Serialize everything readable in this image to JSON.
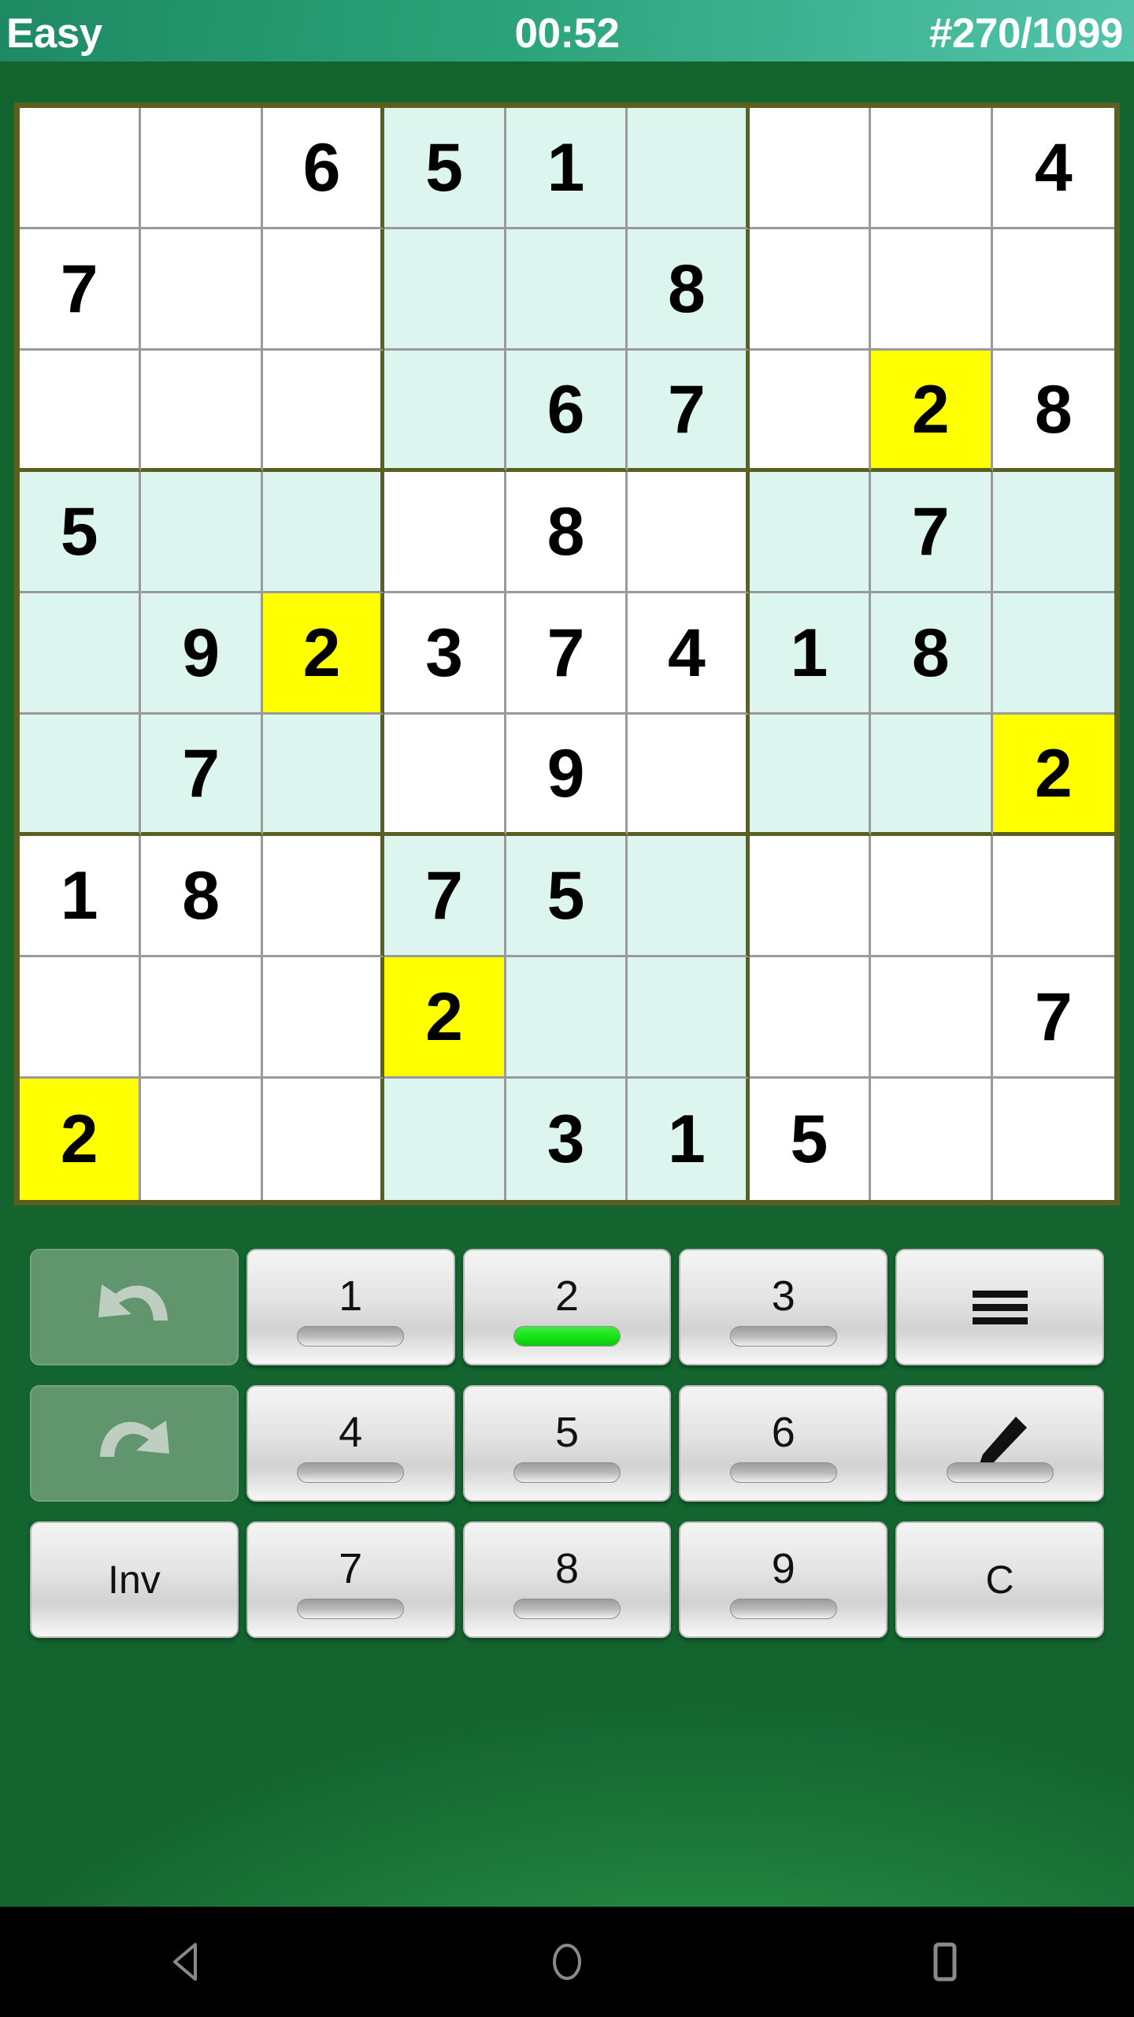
{
  "header": {
    "difficulty": "Easy",
    "timer": "00:52",
    "puzzle_progress": "#270/1099"
  },
  "board": {
    "rows": [
      [
        "",
        "",
        "6",
        "5",
        "1",
        "",
        "",
        "",
        "4"
      ],
      [
        "7",
        "",
        "",
        "",
        "",
        "8",
        "",
        "",
        ""
      ],
      [
        "",
        "",
        "",
        "",
        "6",
        "7",
        "",
        "2",
        "8"
      ],
      [
        "5",
        "",
        "",
        "",
        "8",
        "",
        "",
        "7",
        ""
      ],
      [
        "",
        "9",
        "2",
        "3",
        "7",
        "4",
        "1",
        "8",
        ""
      ],
      [
        "",
        "7",
        "",
        "",
        "9",
        "",
        "",
        "",
        "2"
      ],
      [
        "1",
        "8",
        "",
        "7",
        "5",
        "",
        "",
        "",
        ""
      ],
      [
        "",
        "",
        "",
        "2",
        "",
        "",
        "",
        "",
        "7"
      ],
      [
        "2",
        "",
        "",
        "",
        "3",
        "1",
        "5",
        "",
        ""
      ]
    ],
    "highlighted_cells": [
      [
        0,
        3
      ],
      [
        0,
        4
      ],
      [
        0,
        5
      ],
      [
        1,
        3
      ],
      [
        1,
        4
      ],
      [
        1,
        5
      ],
      [
        2,
        3
      ],
      [
        2,
        4
      ],
      [
        2,
        5
      ],
      [
        3,
        0
      ],
      [
        3,
        1
      ],
      [
        3,
        2
      ],
      [
        3,
        6
      ],
      [
        3,
        7
      ],
      [
        3,
        8
      ],
      [
        4,
        0
      ],
      [
        4,
        1
      ],
      [
        4,
        2
      ],
      [
        4,
        6
      ],
      [
        4,
        7
      ],
      [
        4,
        8
      ],
      [
        5,
        0
      ],
      [
        5,
        1
      ],
      [
        5,
        2
      ],
      [
        5,
        6
      ],
      [
        5,
        7
      ],
      [
        5,
        8
      ],
      [
        6,
        3
      ],
      [
        6,
        4
      ],
      [
        6,
        5
      ],
      [
        7,
        3
      ],
      [
        7,
        4
      ],
      [
        7,
        5
      ],
      [
        8,
        3
      ],
      [
        8,
        4
      ],
      [
        8,
        5
      ]
    ],
    "selected_cells": [
      [
        2,
        7
      ],
      [
        4,
        2
      ],
      [
        5,
        8
      ],
      [
        7,
        3
      ],
      [
        8,
        0
      ]
    ],
    "selected_color": "#ffff00",
    "highlight_color": "#ddf5ef",
    "grid_line_color": "#5b5f20"
  },
  "keypad": {
    "rows": [
      [
        {
          "name": "undo",
          "label": "",
          "icon": "undo-arrow-icon",
          "kind": "dim",
          "bar": null
        },
        {
          "name": "digit-1",
          "label": "1",
          "icon": null,
          "kind": "light",
          "bar": 0
        },
        {
          "name": "digit-2",
          "label": "2",
          "icon": null,
          "kind": "light",
          "bar": 100
        },
        {
          "name": "digit-3",
          "label": "3",
          "icon": null,
          "kind": "light",
          "bar": 0
        },
        {
          "name": "menu",
          "label": "",
          "icon": "hamburger-menu-icon",
          "kind": "light",
          "bar": null
        }
      ],
      [
        {
          "name": "redo",
          "label": "",
          "icon": "redo-arrow-icon",
          "kind": "dim",
          "bar": null
        },
        {
          "name": "digit-4",
          "label": "4",
          "icon": null,
          "kind": "light",
          "bar": 0
        },
        {
          "name": "digit-5",
          "label": "5",
          "icon": null,
          "kind": "light",
          "bar": 0
        },
        {
          "name": "digit-6",
          "label": "6",
          "icon": null,
          "kind": "light",
          "bar": 0
        },
        {
          "name": "pencil-mode",
          "label": "",
          "icon": "pencil-icon",
          "kind": "light",
          "bar": 0
        }
      ],
      [
        {
          "name": "invert",
          "label": "Inv",
          "icon": null,
          "kind": "light",
          "bar": null
        },
        {
          "name": "digit-7",
          "label": "7",
          "icon": null,
          "kind": "light",
          "bar": 0
        },
        {
          "name": "digit-8",
          "label": "8",
          "icon": null,
          "kind": "light",
          "bar": 0
        },
        {
          "name": "digit-9",
          "label": "9",
          "icon": null,
          "kind": "light",
          "bar": 0
        },
        {
          "name": "clear",
          "label": "C",
          "icon": null,
          "kind": "light",
          "bar": null
        }
      ]
    ],
    "bar_fill_color": "#15e215"
  },
  "navbar": {
    "back": "back-triangle-icon",
    "home": "home-circle-icon",
    "recents": "recents-square-icon"
  }
}
